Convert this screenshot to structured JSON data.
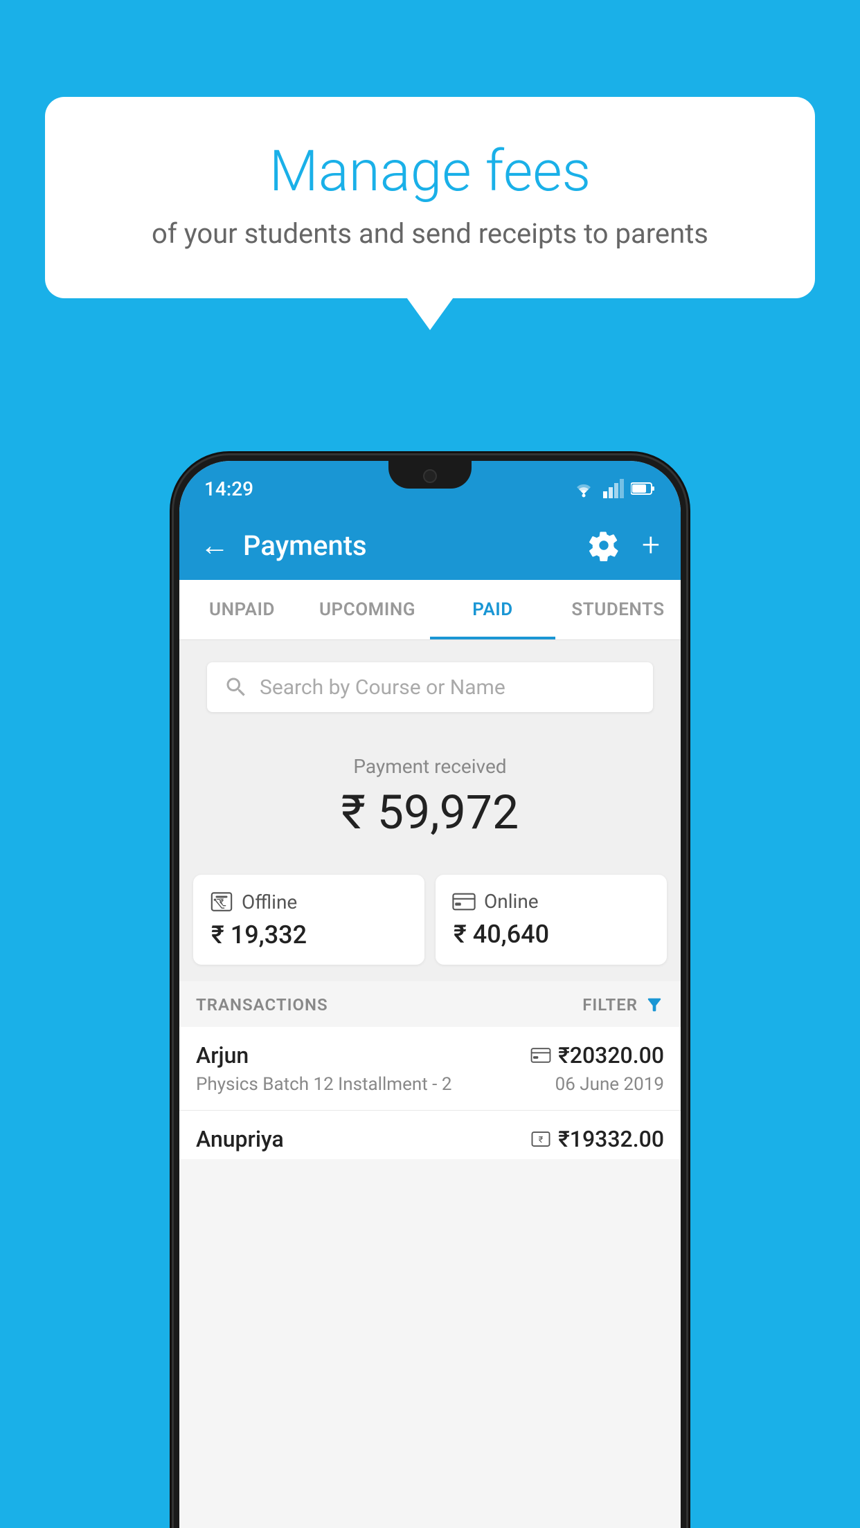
{
  "background_color": "#1ab0e8",
  "bubble": {
    "title": "Manage fees",
    "subtitle": "of your students and send receipts to parents"
  },
  "status_bar": {
    "time": "14:29"
  },
  "header": {
    "title": "Payments",
    "back_label": "←",
    "plus_label": "+"
  },
  "tabs": [
    {
      "label": "UNPAID",
      "active": false
    },
    {
      "label": "UPCOMING",
      "active": false
    },
    {
      "label": "PAID",
      "active": true
    },
    {
      "label": "STUDENTS",
      "active": false
    }
  ],
  "search": {
    "placeholder": "Search by Course or Name"
  },
  "payment_summary": {
    "label": "Payment received",
    "amount": "₹ 59,972"
  },
  "payment_cards": {
    "offline": {
      "label": "Offline",
      "amount": "₹ 19,332"
    },
    "online": {
      "label": "Online",
      "amount": "₹ 40,640"
    }
  },
  "transactions_section": {
    "label": "TRANSACTIONS",
    "filter_label": "FILTER"
  },
  "transactions": [
    {
      "name": "Arjun",
      "course": "Physics Batch 12 Installment - 2",
      "amount": "₹20320.00",
      "date": "06 June 2019",
      "payment_type": "online"
    },
    {
      "name": "Anupriya",
      "course": "",
      "amount": "₹19332.00",
      "date": "",
      "payment_type": "offline"
    }
  ]
}
